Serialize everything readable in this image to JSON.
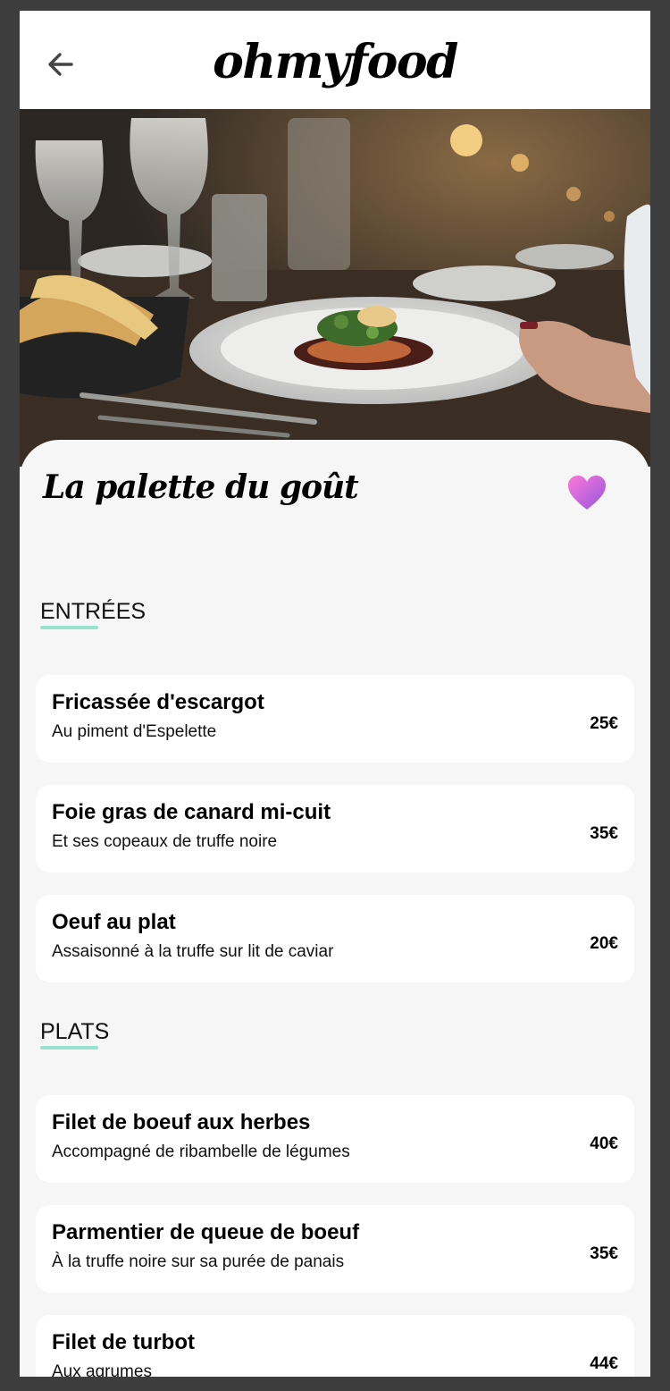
{
  "header": {
    "logo": "ohmyfood",
    "back_icon": "arrow-left-icon"
  },
  "restaurant": {
    "name": "La palette du goût",
    "favorite_icon": "heart-icon",
    "favorite_color": "#d381e3"
  },
  "colors": {
    "accent": "#99e2d0",
    "background": "#f6f6f6"
  },
  "sections": [
    {
      "title": "ENTRÉES",
      "items": [
        {
          "name": "Fricassée d'escargot",
          "description": "Au piment d'Espelette",
          "price": "25€"
        },
        {
          "name": "Foie gras de canard mi-cuit",
          "description": "Et ses copeaux de truffe noire",
          "price": "35€"
        },
        {
          "name": "Oeuf au plat",
          "description": "Assaisonné à la truffe sur lit de caviar",
          "price": "20€"
        }
      ]
    },
    {
      "title": "PLATS",
      "items": [
        {
          "name": "Filet de boeuf aux herbes",
          "description": "Accompagné de ribambelle de légumes",
          "price": "40€"
        },
        {
          "name": "Parmentier de queue de boeuf",
          "description": "À la truffe noire sur sa purée de panais",
          "price": "35€"
        },
        {
          "name": "Filet de turbot",
          "description": "Aux agrumes",
          "price": "44€"
        }
      ]
    }
  ]
}
